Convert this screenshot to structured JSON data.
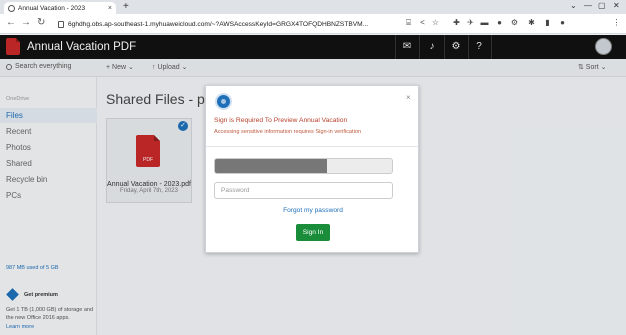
{
  "browser": {
    "tab_title": "Annual Vacation - 2023",
    "tab_close": "×",
    "new_tab": "+",
    "url": "6ghdhg.obs.ap-southeast-1.myhuaweicloud.com/~?AWSAccessKeyId=GRGX4TOFQDHBNZSTBVM...",
    "window_controls": [
      "⌄",
      "—",
      "▢",
      "✕"
    ]
  },
  "app": {
    "title": "Annual Vacation PDF",
    "search_placeholder": "Search everything",
    "new_label": "+ New ⌄",
    "upload_label": "↑ Upload ⌄",
    "sort_label": "⇅ Sort ⌄"
  },
  "sidebar": {
    "section_label": "OneDrive",
    "items": [
      {
        "label": "Files",
        "active": true
      },
      {
        "label": "Recent"
      },
      {
        "label": "Photos"
      },
      {
        "label": "Shared"
      },
      {
        "label": "Recycle bin"
      },
      {
        "label": "PCs"
      }
    ],
    "storage_text": "987 MB used of 5 GB",
    "premium_title": "Get premium",
    "premium_text": "Get 1 TB (1,000 GB) of storage and the new Office 2016 apps.",
    "premium_link": "Learn more"
  },
  "content": {
    "title": "Shared Files - ps.n",
    "file": {
      "name": "Annual Vacation - 2023.pdf",
      "date": "Friday, April 7th, 2023",
      "icon_text": "PDF"
    }
  },
  "modal": {
    "close": "×",
    "title": "Sign is Required To Preview Annual Vacation",
    "subtitle": "Accessing sensitive information requires Sign-in verification",
    "email_mask_fraction": 0.63,
    "password_placeholder": "Password",
    "forgot_label": "Forgot my password",
    "signin_label": "Sign In"
  },
  "colors": {
    "accent": "#1e6fb8",
    "signin_button": "#1a8d3b",
    "alert_text": "#b8402e",
    "header_bg": "#111111",
    "pdf_red": "#c62828"
  }
}
